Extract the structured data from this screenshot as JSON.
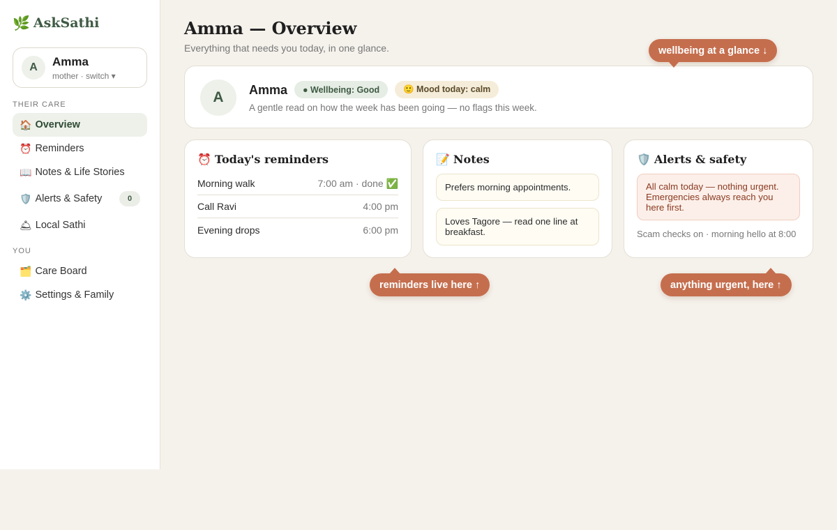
{
  "brand": {
    "name": "AskSathi",
    "icon": "leaf-icon"
  },
  "profile": {
    "initial": "A",
    "name": "Amma",
    "subtitle": "mother · switch ▾"
  },
  "sidebar": {
    "section_care": "THEIR CARE",
    "section_you": "YOU",
    "items": [
      {
        "icon": "🏠",
        "icon_name": "home-icon",
        "label": "Overview",
        "active": true
      },
      {
        "icon": "⏰",
        "icon_name": "alarm-clock-icon",
        "label": "Reminders"
      },
      {
        "icon": "📖",
        "icon_name": "book-icon",
        "label": "Notes & Life Stories"
      },
      {
        "icon": "🛡️",
        "icon_name": "shield-icon",
        "label": "Alerts & Safety",
        "badge": "0"
      },
      {
        "icon": "🛎",
        "icon_name": "bell-icon",
        "label": "Local Sathi"
      },
      {
        "icon": "🗂️",
        "icon_name": "folder-icon",
        "label": "Care Board"
      },
      {
        "icon": "⚙️",
        "icon_name": "gear-icon",
        "label": "Settings & Family"
      }
    ]
  },
  "header": {
    "title": "Amma — Overview",
    "subtitle": "Everything that needs you today, in one glance."
  },
  "hero": {
    "initial": "A",
    "name": "Amma",
    "wellbeing": "● Wellbeing: Good",
    "mood": "🙂 Mood today: calm",
    "description": "A gentle read on how the week has been going — no flags this week."
  },
  "reminders": {
    "title": "Today's reminders",
    "icon": "⏰",
    "items": [
      {
        "label": "Morning walk",
        "time": "7:00 am · done ✅"
      },
      {
        "label": "Call Ravi",
        "time": "4:00 pm"
      },
      {
        "label": "Evening drops",
        "time": "6:00 pm"
      }
    ]
  },
  "notes": {
    "title": "Notes",
    "icon": "📝",
    "items": [
      "Prefers morning appointments.",
      "Loves Tagore — read one line at breakfast."
    ]
  },
  "alerts": {
    "title": "Alerts & safety",
    "icon": "🛡️",
    "message": "All calm today — nothing urgent. Emergencies always reach you here first.",
    "footer": "Scam checks on · morning hello at 8:00"
  },
  "tooltips": {
    "glance": "wellbeing at a glance ↓",
    "reminders": "reminders live here ↑",
    "urgent": "anything urgent, here ↑"
  },
  "colors": {
    "brand": "#3f5a44",
    "accent": "#c56e4e",
    "background": "#f5f2ec"
  }
}
